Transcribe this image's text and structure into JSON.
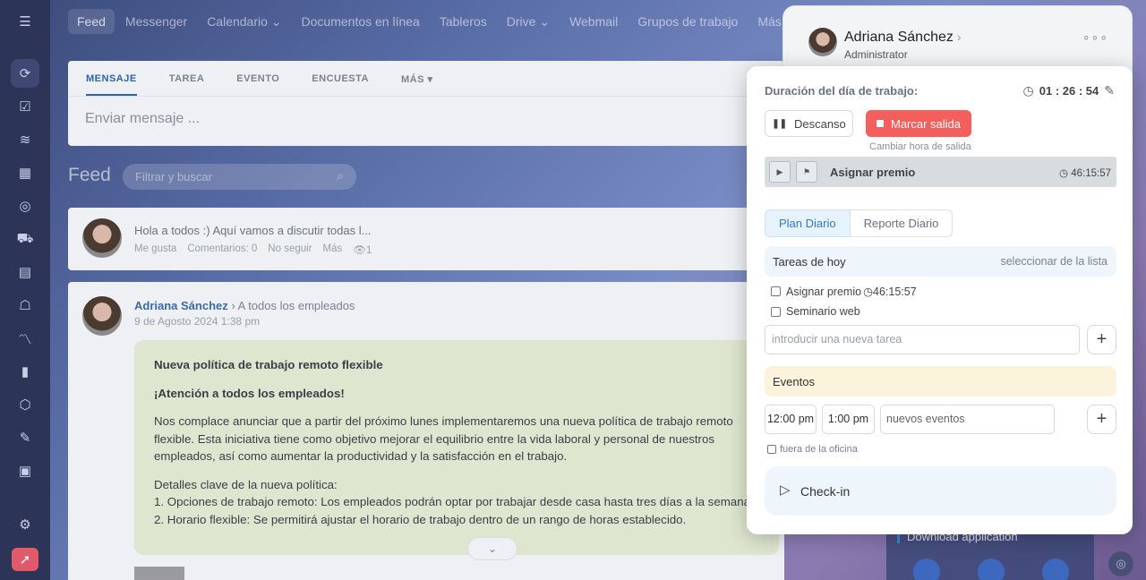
{
  "topnav": {
    "items": [
      "Feed",
      "Messenger",
      "Calendario",
      "Documentos en línea",
      "Tableros",
      "Drive",
      "Webmail",
      "Grupos de trabajo",
      "Más"
    ]
  },
  "composer": {
    "tabs": [
      "MENSAJE",
      "TAREA",
      "EVENTO",
      "ENCUESTA",
      "MÁS"
    ],
    "placeholder": "Enviar mensaje ..."
  },
  "feed": {
    "title": "Feed",
    "search_placeholder": "Filtrar y buscar",
    "post1": {
      "text": "Hola a todos :) Aquí vamos a discutir todas l...",
      "like": "Me gusta",
      "comments": "Comentarios: 0",
      "unfollow": "No seguir",
      "more": "Más",
      "views": "1"
    },
    "post2": {
      "author": "Adriana Sánchez",
      "audience": "A todos los empleados",
      "date": "9 de Agosto 2024 1:38 pm",
      "heading": "Nueva política de trabajo remoto flexible",
      "subheading": "¡Atención a todos los empleados!",
      "para1": "Nos complace anunciar que a partir del próximo lunes implementaremos una nueva política de trabajo remoto flexible. Esta iniciativa tiene como objetivo mejorar el equilibrio entre la vida laboral y personal de nuestros empleados, así como aumentar la productividad y la satisfacción en el trabajo.",
      "para2_title": "Detalles clave de la nueva política:",
      "para2_line1": "1. Opciones de trabajo remoto: Los empleados podrán optar por trabajar desde casa hasta tres días a la semana.",
      "para2_line2": "2. Horario flexible: Se permitirá ajustar el horario de trabajo dentro de un rango de horas establecido."
    }
  },
  "sidebar_right": {
    "download": "Download application"
  },
  "profile": {
    "name": "Adriana Sánchez",
    "role": "Administrator"
  },
  "workday": {
    "label": "Duración del día de trabajo:",
    "timer": "01 : 26 : 54",
    "break_label": "Descanso",
    "clock_out_label": "Marcar salida",
    "change_time": "Cambiar hora de salida",
    "current_task": "Asignar premio",
    "current_task_time": "46:15:57",
    "tabs": [
      "Plan Diario",
      "Reporte Diario"
    ],
    "today_title": "Tareas de hoy",
    "select_from_list": "seleccionar de la lista",
    "tasks": [
      {
        "label": "Asignar premio",
        "time": "46:15:57"
      },
      {
        "label": "Seminario web",
        "time": ""
      }
    ],
    "new_task_placeholder": "introducir una nueva tarea",
    "events_title": "Eventos",
    "event_start": "12:00 pm",
    "event_end": "1:00 pm",
    "new_event_placeholder": "nuevos eventos",
    "outside_office": "fuera de la oficina",
    "checkin_label": "Check-in"
  },
  "colors": {
    "accent": "#2f7cc4",
    "danger": "#f25f5c",
    "rail": "#2c3458"
  }
}
